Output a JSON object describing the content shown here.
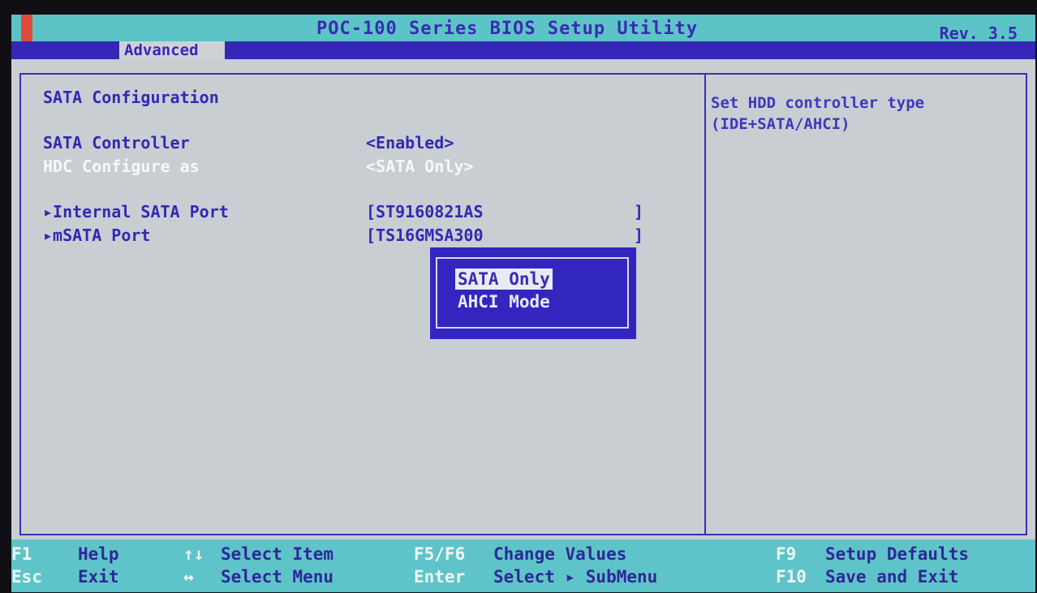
{
  "header": {
    "title": "POC-100 Series BIOS Setup Utility",
    "revision": "Rev. 3.5",
    "active_tab": "Advanced"
  },
  "main": {
    "section_title": "SATA Configuration",
    "settings": [
      {
        "label": "SATA Controller",
        "value": "<Enabled>"
      },
      {
        "label": "HDC Configure as",
        "value": "<SATA Only>"
      }
    ],
    "submenus": [
      {
        "label": "▸Internal SATA Port",
        "value": "[ST9160821AS",
        "close": "]"
      },
      {
        "label": "▸mSATA Port",
        "value": "[TS16GMSA300",
        "close": "]"
      }
    ]
  },
  "help": {
    "line1": "Set HDD controller type",
    "line2": "(IDE+SATA/AHCI)"
  },
  "popup": {
    "options": [
      "SATA Only",
      "AHCI Mode"
    ],
    "selected": "SATA Only"
  },
  "footer": {
    "f1_key": "F1",
    "f1_label": "Help",
    "esc_key": "Esc",
    "esc_label": "Exit",
    "updown_key": "↑↓",
    "updown_label": "Select Item",
    "leftright_key": "↔",
    "leftright_label": "Select Menu",
    "f5f6_key": "F5/F6",
    "f5f6_label": "Change Values",
    "enter_key": "Enter",
    "enter_label": "Select ▸ SubMenu",
    "f9_key": "F9",
    "f9_label": "Setup Defaults",
    "f10_key": "F10",
    "f10_label": "Save and Exit"
  },
  "colors": {
    "screen_bg": "#c9ced2",
    "title_bar": "#5cc4c7",
    "tab_bar": "#3528b6",
    "text_blue": "#3329b5",
    "popup_bg": "#3326c0"
  }
}
